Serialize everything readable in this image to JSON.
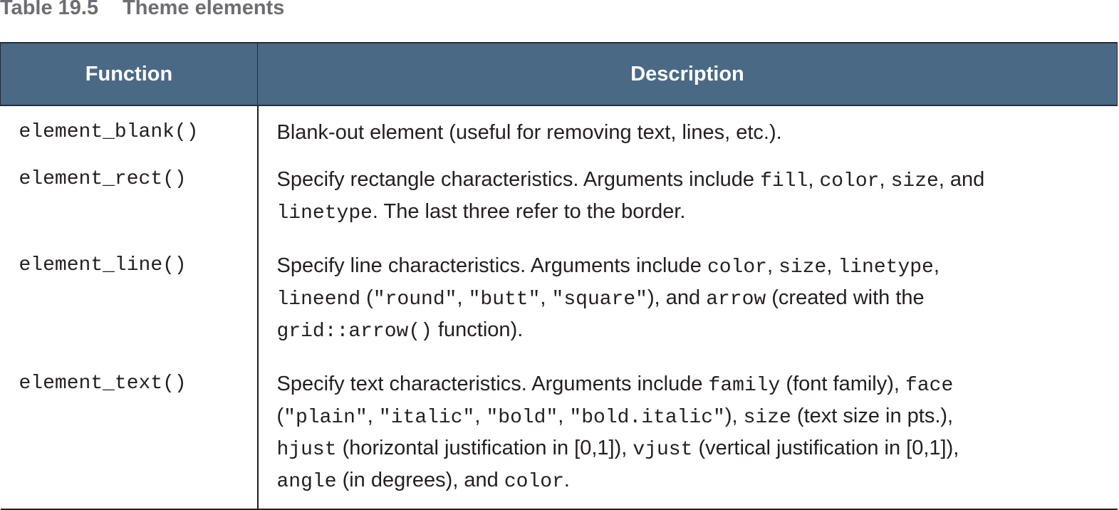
{
  "caption": {
    "label": "Table 19.5",
    "title": "Theme elements"
  },
  "table": {
    "headers": [
      "Function",
      "Description"
    ],
    "rows": [
      {
        "function": "element_blank()",
        "description": [
          {
            "t": "Blank-out element (useful for removing text, lines, etc.)."
          }
        ]
      },
      {
        "function": "element_rect()",
        "description": [
          {
            "t": "Specify rectangle characteristics. Arguments include "
          },
          {
            "c": "fill"
          },
          {
            "t": ", "
          },
          {
            "c": "color"
          },
          {
            "t": ", "
          },
          {
            "c": "size"
          },
          {
            "t": ", and "
          },
          {
            "br": true
          },
          {
            "c": "linetype"
          },
          {
            "t": ". The last three refer to the border."
          }
        ]
      },
      {
        "function": "element_line()",
        "description": [
          {
            "t": "Specify line characteristics. Arguments include "
          },
          {
            "c": "color"
          },
          {
            "t": ", "
          },
          {
            "c": "size"
          },
          {
            "t": ", "
          },
          {
            "c": "linetype"
          },
          {
            "t": ","
          },
          {
            "br": true
          },
          {
            "c": "lineend"
          },
          {
            "t": " ("
          },
          {
            "c": "\"round\""
          },
          {
            "t": ", "
          },
          {
            "c": "\"butt\""
          },
          {
            "t": ", "
          },
          {
            "c": "\"square\""
          },
          {
            "t": "), and "
          },
          {
            "c": "arrow"
          },
          {
            "t": " (created with the"
          },
          {
            "br": true
          },
          {
            "c": "grid::arrow()"
          },
          {
            "t": " function)."
          }
        ]
      },
      {
        "function": "element_text()",
        "description": [
          {
            "t": "Specify text characteristics. Arguments include "
          },
          {
            "c": "family"
          },
          {
            "t": " (font family), "
          },
          {
            "c": "face"
          },
          {
            "br": true
          },
          {
            "t": "("
          },
          {
            "c": "\"plain\""
          },
          {
            "t": ", "
          },
          {
            "c": "\"italic\""
          },
          {
            "t": ", "
          },
          {
            "c": "\"bold\""
          },
          {
            "t": ", "
          },
          {
            "c": "\"bold.italic\""
          },
          {
            "t": "), "
          },
          {
            "c": "size"
          },
          {
            "t": " (text size in pts.),"
          },
          {
            "br": true
          },
          {
            "c": "hjust"
          },
          {
            "t": " (horizontal justification in [0,1]), "
          },
          {
            "c": "vjust"
          },
          {
            "t": " (vertical justification in [0,1]),"
          },
          {
            "br": true
          },
          {
            "c": "angle"
          },
          {
            "t": " (in degrees), and "
          },
          {
            "c": "color"
          },
          {
            "t": "."
          }
        ]
      }
    ]
  }
}
